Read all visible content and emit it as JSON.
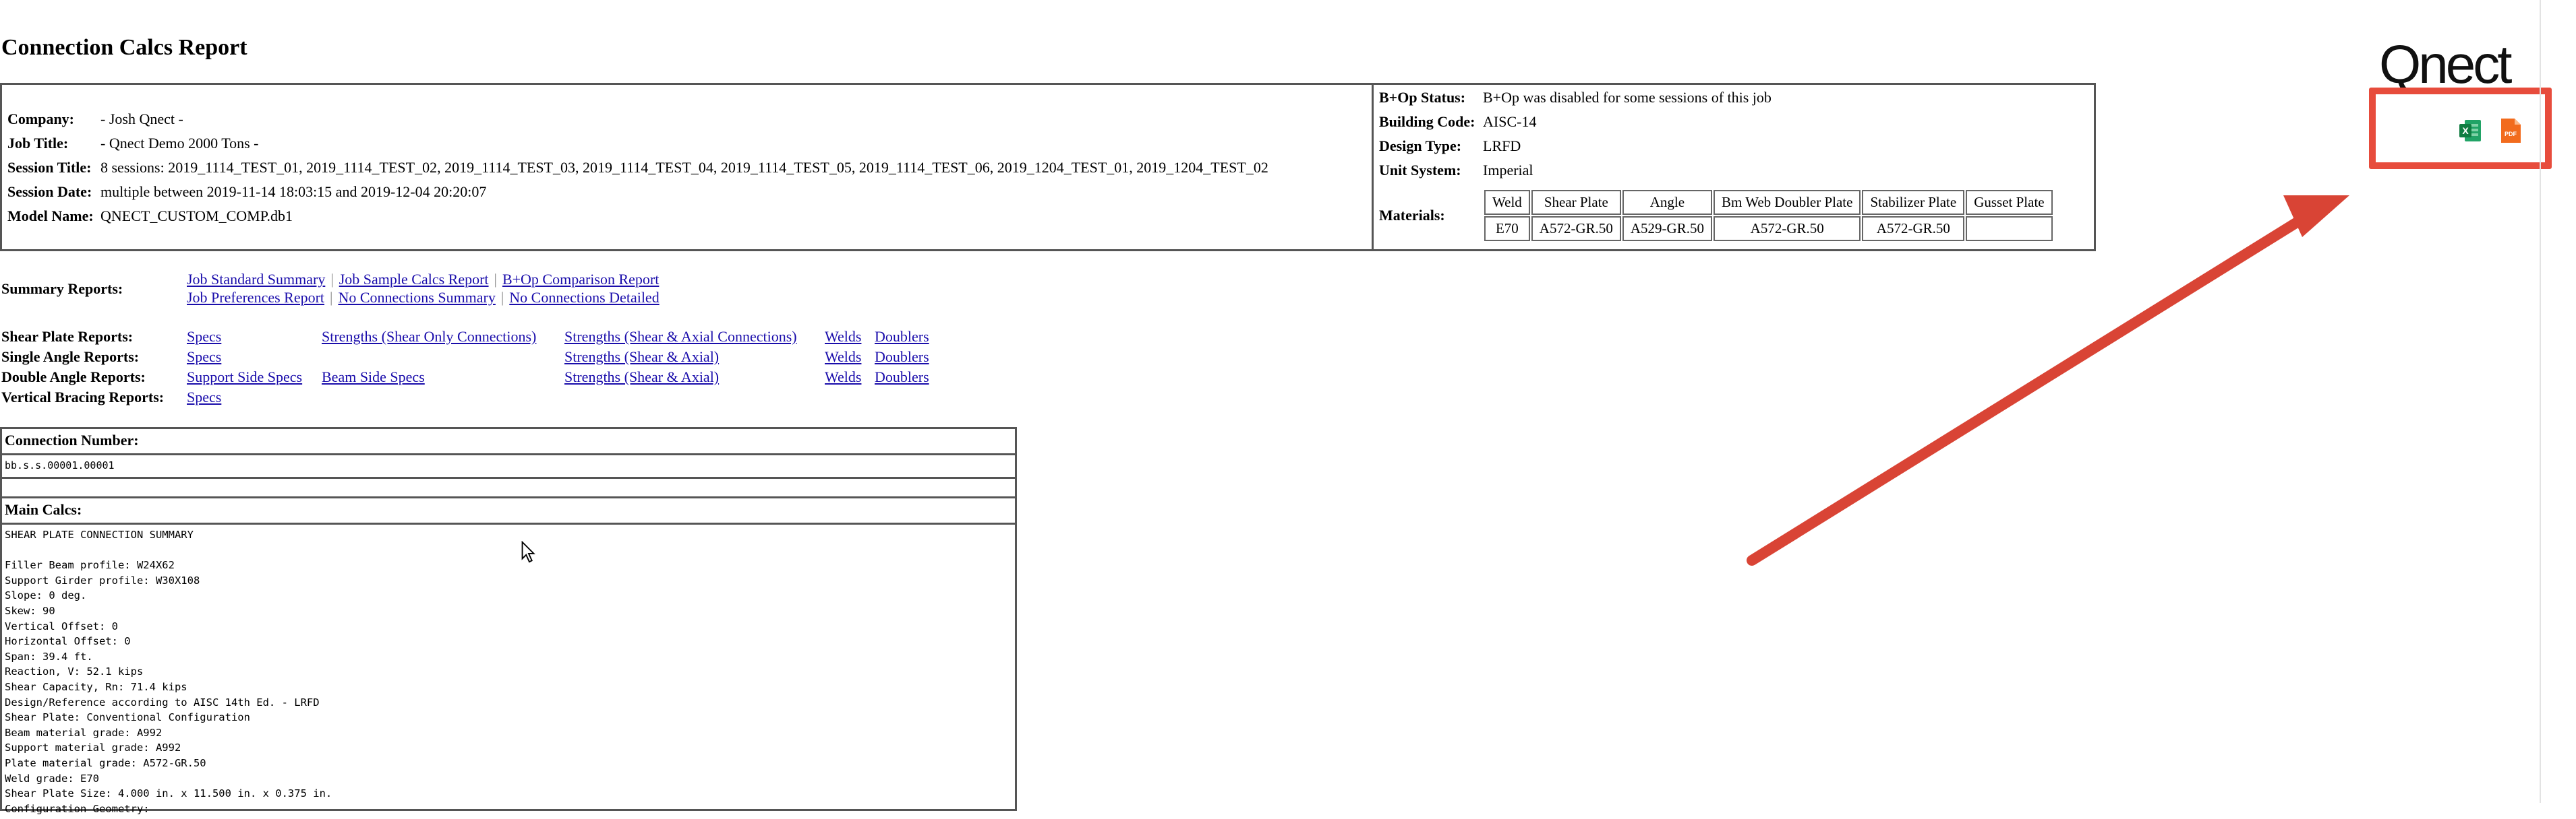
{
  "page": {
    "title": "Connection Calcs Report"
  },
  "info": {
    "left": [
      {
        "key": "Company:",
        "value": "- Josh Qnect -"
      },
      {
        "key": "Job Title:",
        "value": "- Qnect Demo 2000 Tons -"
      },
      {
        "key": "Session Title:",
        "value": "8 sessions: 2019_1114_TEST_01, 2019_1114_TEST_02, 2019_1114_TEST_03, 2019_1114_TEST_04, 2019_1114_TEST_05, 2019_1114_TEST_06, 2019_1204_TEST_01, 2019_1204_TEST_02"
      },
      {
        "key": "Session Date:",
        "value": "multiple between 2019-11-14 18:03:15 and 2019-12-04 20:20:07"
      },
      {
        "key": "Model Name:",
        "value": "QNECT_CUSTOM_COMP.db1"
      }
    ],
    "right": [
      {
        "key": "B+Op Status:",
        "value": "B+Op was disabled for some sessions of this job"
      },
      {
        "key": "Building Code:",
        "value": "AISC-14"
      },
      {
        "key": "Design Type:",
        "value": "LRFD"
      },
      {
        "key": "Unit System:",
        "value": "Imperial"
      }
    ],
    "materials_label": "Materials:",
    "materials": {
      "headers": [
        "Weld",
        "Shear Plate",
        "Angle",
        "Bm Web Doubler Plate",
        "Stabilizer Plate",
        "Gusset Plate"
      ],
      "values": [
        "E70",
        "A572-GR.50",
        "A529-GR.50",
        "A572-GR.50",
        "A572-GR.50",
        ""
      ]
    }
  },
  "summary": {
    "label": "Summary Reports:",
    "line1": [
      "Job Standard Summary",
      "Job Sample Calcs Report",
      "B+Op Comparison Report"
    ],
    "line2": [
      "Job Preferences Report",
      "No Connections Summary",
      "No Connections Detailed"
    ]
  },
  "reports": {
    "shear_plate": {
      "label": "Shear Plate Reports:",
      "specs": "Specs",
      "strength1": "Strengths (Shear Only Connections)",
      "strength2": "Strengths (Shear & Axial Connections)",
      "welds": "Welds",
      "doublers": "Doublers"
    },
    "single_angle": {
      "label": "Single Angle Reports:",
      "specs": "Specs",
      "strength": "Strengths (Shear & Axial)",
      "welds": "Welds",
      "doublers": "Doublers"
    },
    "double_angle": {
      "label": "Double Angle Reports:",
      "support_specs": "Support Side Specs",
      "beam_specs": "Beam Side Specs",
      "strength": "Strengths (Shear & Axial)",
      "welds": "Welds",
      "doublers": "Doublers"
    },
    "vertical_bracing": {
      "label": "Vertical Bracing Reports:",
      "specs": "Specs"
    }
  },
  "connection": {
    "number_label": "Connection Number:",
    "number": "bb.s.s.00001.00001",
    "main_calcs_label": "Main Calcs:",
    "lines": [
      "SHEAR PLATE CONNECTION SUMMARY",
      "",
      "Filler Beam profile: W24X62",
      "Support Girder profile: W30X108",
      "Slope: 0 deg.",
      "Skew: 90",
      "Vertical Offset: 0",
      "Horizontal Offset: 0",
      "Span: 39.4 ft.",
      "Reaction, V: 52.1 kips",
      "Shear Capacity, Rn: 71.4 kips",
      "Design/Reference according to AISC 14th Ed. - LRFD",
      "Shear Plate: Conventional Configuration",
      "Beam material grade: A992",
      "Support material grade: A992",
      "Plate material grade: A572-GR.50",
      "Weld grade: E70",
      "Shear Plate Size: 4.000 in. x 11.500 in. x 0.375 in.",
      "Configuration Geometry:"
    ]
  },
  "branding": {
    "logo": "Qnect"
  },
  "export": {
    "excel_icon": "excel-icon",
    "pdf_icon": "pdf-icon",
    "highlight_color": "#e74c3c"
  }
}
